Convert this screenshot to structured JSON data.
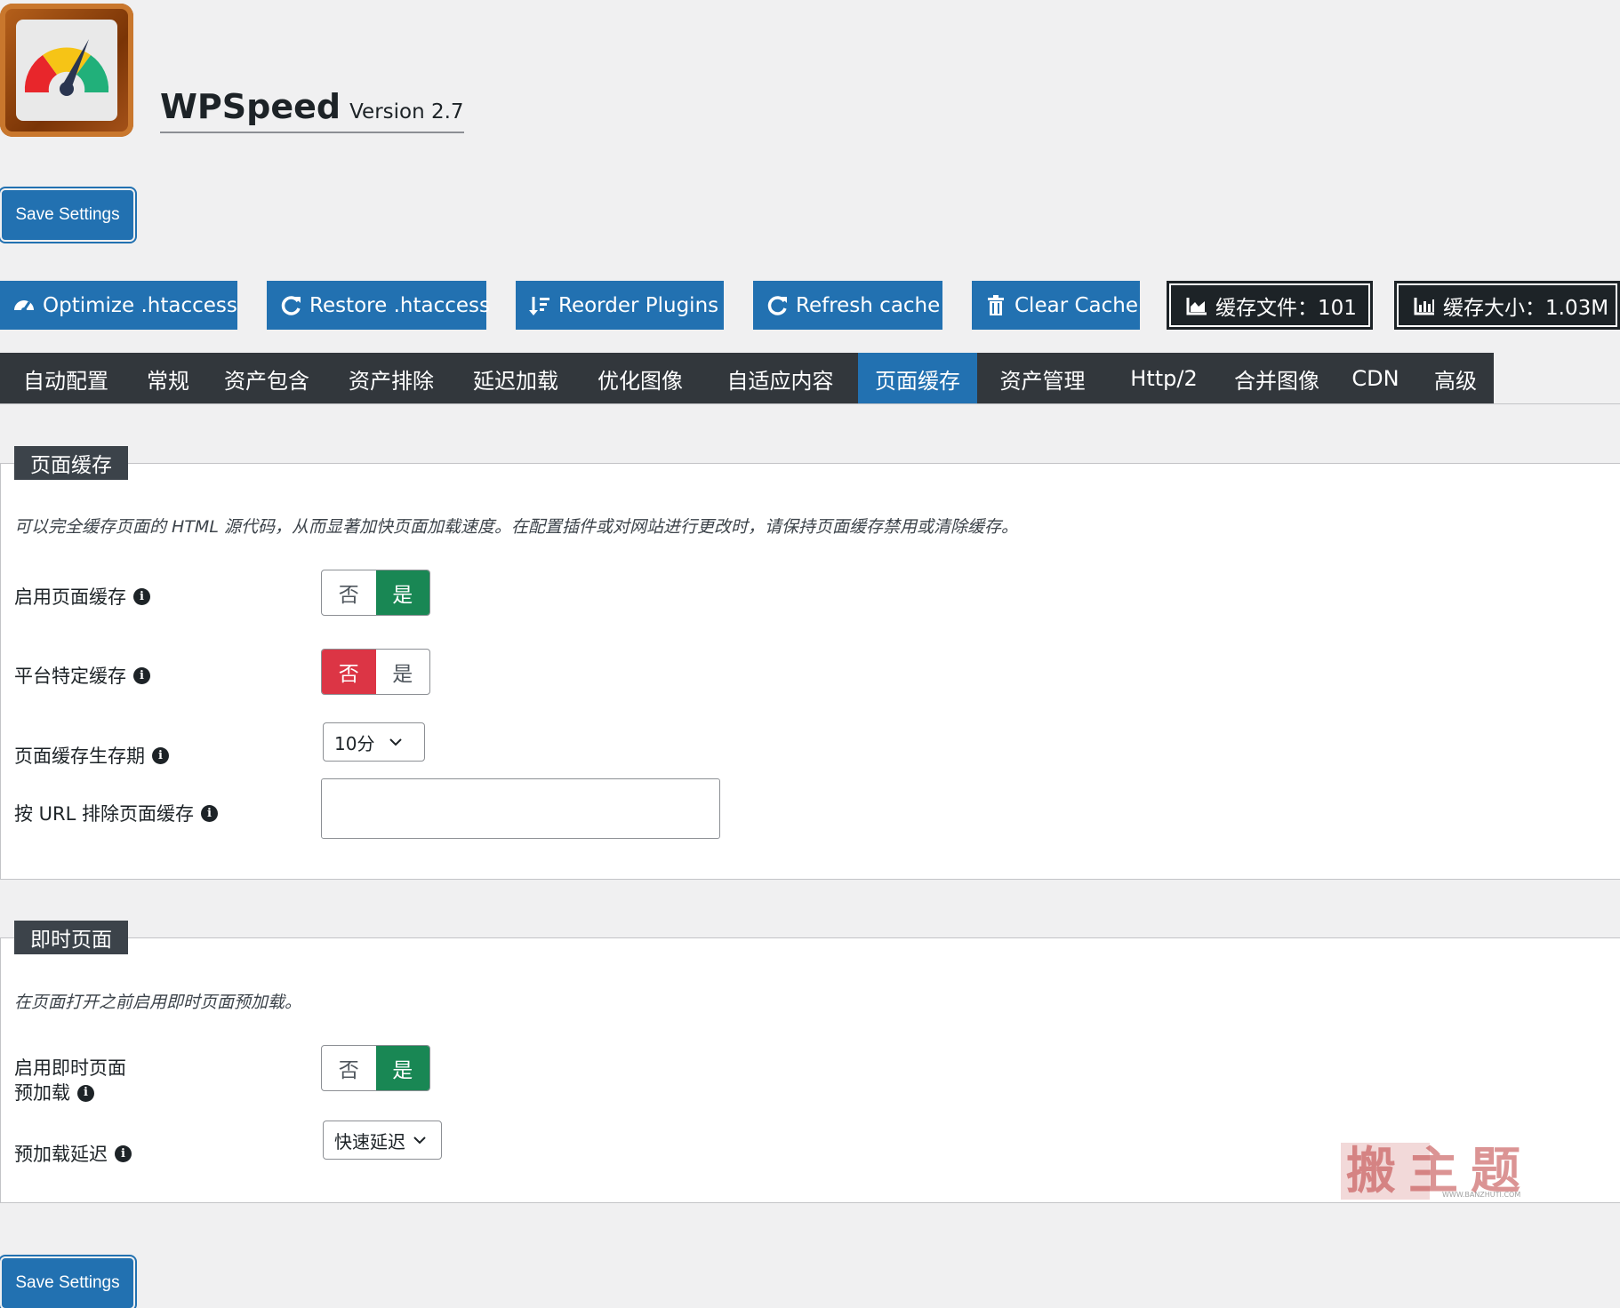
{
  "header": {
    "title": "WPSpeed",
    "version": "Version 2.7"
  },
  "save_button": "Save Settings",
  "actions": [
    {
      "label": "Optimize .htaccess",
      "icon": "gauge-icon"
    },
    {
      "label": "Restore .htaccess",
      "icon": "refresh-icon"
    },
    {
      "label": "Reorder Plugins",
      "icon": "sort-icon"
    },
    {
      "label": "Refresh cache",
      "icon": "refresh-icon"
    },
    {
      "label": "Clear Cache",
      "icon": "trash-icon"
    }
  ],
  "stats": [
    {
      "label": "缓存文件：101",
      "icon": "area-chart-icon"
    },
    {
      "label": "缓存大小：1.03M",
      "icon": "bar-chart-icon"
    }
  ],
  "tabs": [
    "自动配置",
    "常规",
    "资产包含",
    "资产排除",
    "延迟加载",
    "优化图像",
    "自适应内容",
    "页面缓存",
    "资产管理",
    "Http/2",
    "合并图像",
    "CDN",
    "高级"
  ],
  "active_tab": "页面缓存",
  "page_cache": {
    "legend": "页面缓存",
    "description": "可以完全缓存页面的 HTML 源代码，从而显著加快页面加载速度。在配置插件或对网站进行更改时，请保持页面缓存禁用或清除缓存。",
    "enable_label": "启用页面缓存",
    "platform_label": "平台特定缓存",
    "lifetime_label": "页面缓存生存期",
    "lifetime_value": "10分",
    "exclude_label": "按 URL 排除页面缓存",
    "exclude_value": ""
  },
  "instant_page": {
    "legend": "即时页面",
    "description": "在页面打开之前启用即时页面预加载。",
    "enable_label_line1": "启用即时页面",
    "enable_label_line2": "预加载",
    "delay_label": "预加载延迟",
    "delay_value": "快速延迟"
  },
  "toggle": {
    "no": "否",
    "yes": "是"
  },
  "toggles": {
    "enable_page_cache": "是",
    "platform_cache": "否",
    "enable_instant": "是"
  },
  "watermark": {
    "text": "搬主题",
    "url": "WWW.BANZHUTI.COM"
  },
  "colors": {
    "primary": "#2271b1",
    "tab_bg": "#32373c",
    "yes_green": "#198754",
    "no_red": "#dc3545"
  }
}
